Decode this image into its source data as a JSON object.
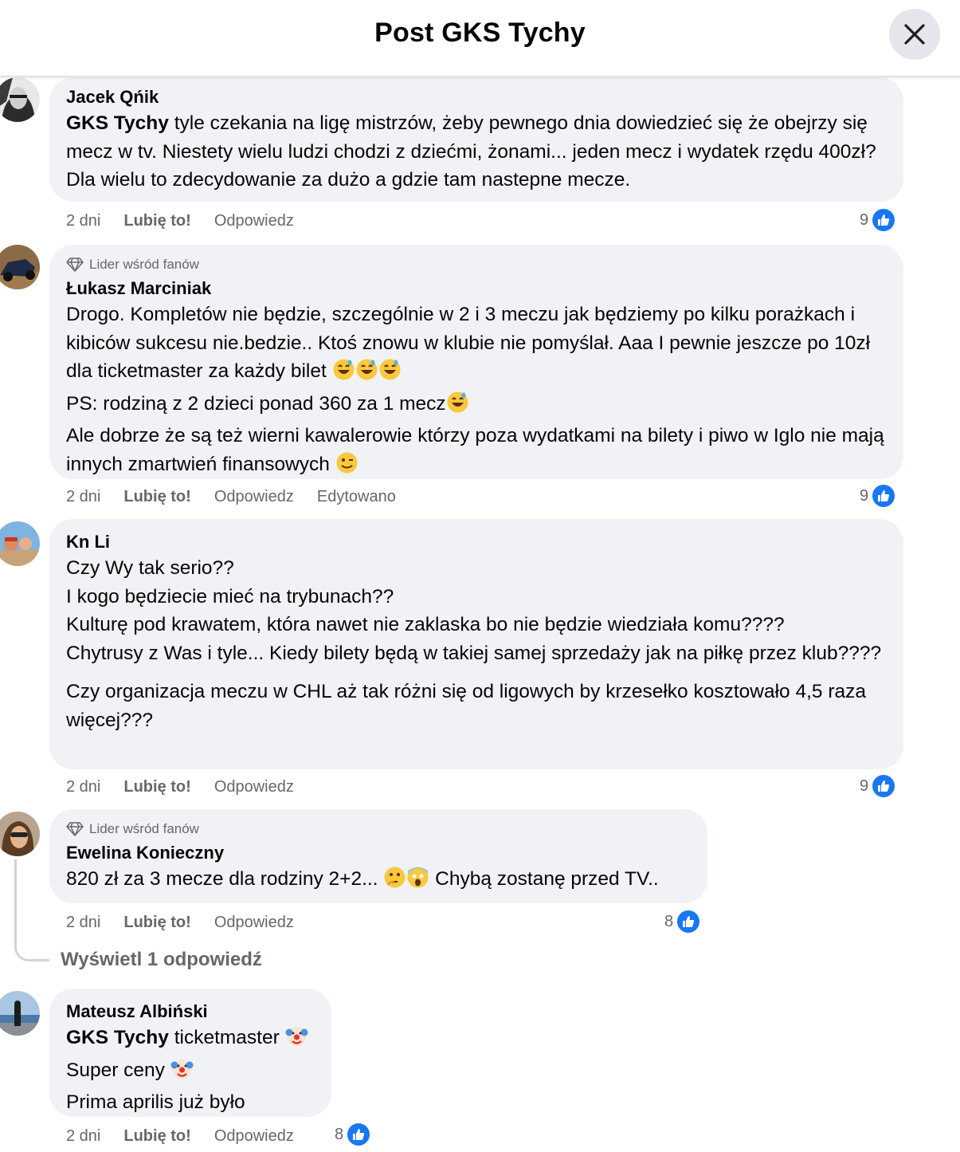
{
  "header": {
    "title": "Post GKS Tychy",
    "close_icon": "close-icon"
  },
  "comments": [
    {
      "author": "Jacek Qńik",
      "badge": "",
      "mention": "GKS Tychy",
      "text": " tyle czekania na ligę mistrzów, żeby pewnego dnia dowiedzieć się że obejrzy się mecz w tv. Niestety wielu ludzi chodzi z dziećmi, żonami... jeden mecz i wydatek rzędu 400zł? Dla wielu to zdecydowanie za dużo a gdzie tam nastepne mecze.",
      "time": "2 dni",
      "like": "Lubię to!",
      "reply": "Odpowiedz",
      "edited": "",
      "reactions": "9"
    },
    {
      "author": "Łukasz Marciniak",
      "badge": "Lider wśród fanów",
      "line1": "Drogo. Kompletów nie będzie, szczególnie w 2 i 3 meczu jak będziemy po kilku porażkach i kibiców sukcesu nie.bedzie.. Ktoś znowu w klubie nie pomyślał. Aaa I pewnie jeszcze po 10zł dla ticketmaster za każdy bilet ",
      "line2": "PS: rodziną z 2 dzieci ponad 360 za 1 mecz",
      "line3": "Ale dobrze że są też wierni kawalerowie którzy poza wydatkami na bilety i piwo w Iglo nie mają innych zmartwień finansowych ",
      "time": "2 dni",
      "like": "Lubię to!",
      "reply": "Odpowiedz",
      "edited": "Edytowano",
      "reactions": "9"
    },
    {
      "author": "Kn Li",
      "badge": "",
      "para1": "Czy Wy tak serio??\nI kogo będziecie mieć na trybunach??\nKulturę pod krawatem, która nawet nie zaklaska bo nie będzie wiedziała komu????\nChytrusy z Was i tyle... Kiedy bilety będą w takiej samej sprzedaży jak na piłkę przez klub????",
      "para2": "Czy organizacja meczu w CHL aż tak różni się od ligowych by krzesełko kosztowało 4,5 raza więcej???",
      "time": "2 dni",
      "like": "Lubię to!",
      "reply": "Odpowiedz",
      "edited": "",
      "reactions": "9"
    },
    {
      "author": "Ewelina Konieczny",
      "badge": "Lider wśród fanów",
      "text_a": "820 zł za 3 mecze dla rodziny 2+2... ",
      "text_b": " Chybą zostanę przed TV..",
      "time": "2 dni",
      "like": "Lubię to!",
      "reply": "Odpowiedz",
      "edited": "",
      "reactions": "8",
      "view_replies": "Wyświetl 1 odpowiedź"
    },
    {
      "author": "Mateusz Albiński",
      "badge": "",
      "mention": "GKS Tychy",
      "text_a": " ticketmaster ",
      "text_b": "Super ceny ",
      "text_c": "Prima aprilis już było",
      "time": "2 dni",
      "like": "Lubię to!",
      "reply": "Odpowiedz",
      "edited": "",
      "reactions": "8"
    }
  ],
  "colors": {
    "like_blue": "#1877f2",
    "bubble_bg": "#f0f2f5",
    "meta_gray": "#65676b"
  }
}
